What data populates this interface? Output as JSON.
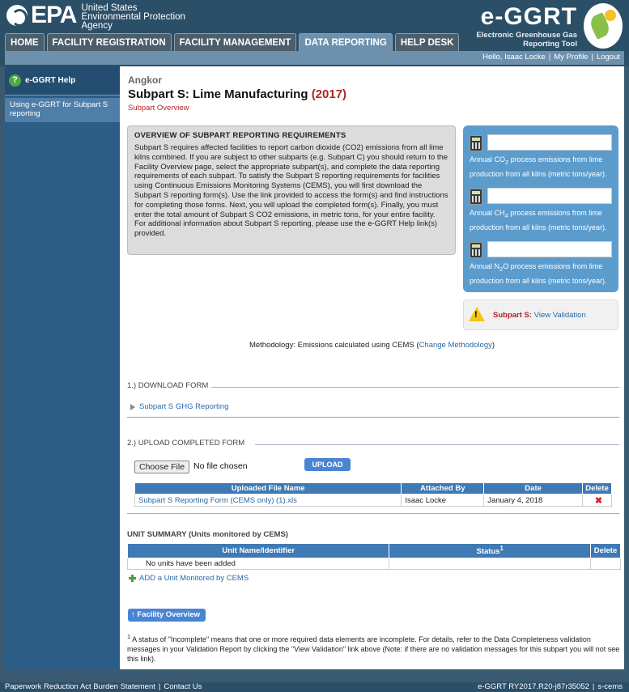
{
  "brand": {
    "agency_word": "EPA",
    "agency_line1": "United States",
    "agency_line2": "Environmental Protection",
    "agency_line3": "Agency",
    "app_title": "e-GGRT",
    "app_sub1": "Electronic Greenhouse Gas",
    "app_sub2": "Reporting Tool"
  },
  "nav": {
    "tabs": [
      "HOME",
      "FACILITY REGISTRATION",
      "FACILITY MANAGEMENT",
      "DATA REPORTING",
      "HELP DESK"
    ],
    "active": "DATA REPORTING"
  },
  "userbar": {
    "greeting": "Hello, Isaac Locke",
    "my_profile": "My Profile",
    "logout": "Logout",
    "sep": "|"
  },
  "sidebar": {
    "help_title": "e-GGRT Help",
    "link": "Using e-GGRT for Subpart S reporting"
  },
  "page": {
    "facility": "Angkor",
    "title": "Subpart S: Lime Manufacturing",
    "year": "(2017)",
    "subtitle": "Subpart Overview"
  },
  "overview": {
    "heading": "OVERVIEW OF SUBPART REPORTING REQUIREMENTS",
    "body": "Subpart S requires affected facilities to report carbon dioxide (CO2) emissions from all lime kilns combined. If you are subject to other subparts (e.g. Subpart C) you should return to the Facility Overview page, select the appropriate subpart(s), and complete the data reporting requirements of each subpart. To satisfy the Subpart S reporting requirements for facilities using Continuous Emissions Monitoring Systems (CEMS), you will first download the Subpart S reporting form(s). Use the link provided to access the form(s) and find instructions for completing those forms. Next, you will upload the completed form(s). Finally, you must enter the total amount of Subpart S CO2 emissions, in metric tons, for your entire facility. For additional information about Subpart S reporting, please use the e-GGRT Help link(s) provided."
  },
  "emissions": [
    {
      "pre": "Annual CO",
      "sub": "2",
      "post": " process emissions from lime production from all kilns (metric tons/year).",
      "value": ""
    },
    {
      "pre": "Annual CH",
      "sub": "4",
      "post": " process emissions from lime production from all kilns (metric tons/year).",
      "value": ""
    },
    {
      "pre": "Annual N",
      "sub": "2",
      "post": "O process emissions from lime production from all kilns (metric tons/year).",
      "value": ""
    }
  ],
  "validation": {
    "label": "Subpart S:",
    "link": "View Validation"
  },
  "methodology": {
    "text": "Methodology: Emissions calculated using CEMS (",
    "link": "Change Methodology",
    "close": ")"
  },
  "download": {
    "heading": "1.) DOWNLOAD FORM",
    "link": "Subpart S GHG Reporting"
  },
  "upload": {
    "heading": "2.) UPLOAD COMPLETED FORM",
    "choose": "Choose File",
    "nofile": "No file chosen",
    "button": "UPLOAD",
    "columns": [
      "Uploaded File Name",
      "Attached By",
      "Date",
      "Delete"
    ],
    "rows": [
      {
        "file": "Subpart S Reporting Form (CEMS only) (1).xls",
        "by": "Isaac Locke",
        "date": "January 4, 2018",
        "del": "✖"
      }
    ]
  },
  "units": {
    "heading": "UNIT SUMMARY (Units monitored by CEMS)",
    "columns": [
      "Unit Name/Identifier",
      "Status",
      "Delete"
    ],
    "status_sup": "1",
    "empty": "No units have been added",
    "add": "ADD a Unit Monitored by CEMS"
  },
  "facility_button": "Facility Overview",
  "footnote": {
    "sup": "1",
    "text": " A status of \"Incomplete\" means that one or more required data elements are incomplete. For details, refer to the Data Completeness validation messages in your Validation Report by clicking the \"View Validation\" link above (Note: if there are no validation messages for this subpart you will not see this link)."
  },
  "footer": {
    "left1": "Paperwork Reduction Act Burden Statement",
    "left2": "Contact Us",
    "right1": "e-GGRT RY2017.R20-j87r35052",
    "right2": "s-cems",
    "sep": "|"
  },
  "colors": {
    "header": "#2c4f68",
    "tab_active": "#6d91ad",
    "table_head": "#3f7ab5",
    "accent_red": "#b22222",
    "link": "#2a6aa8",
    "emis_panel": "#5b9ccd"
  }
}
